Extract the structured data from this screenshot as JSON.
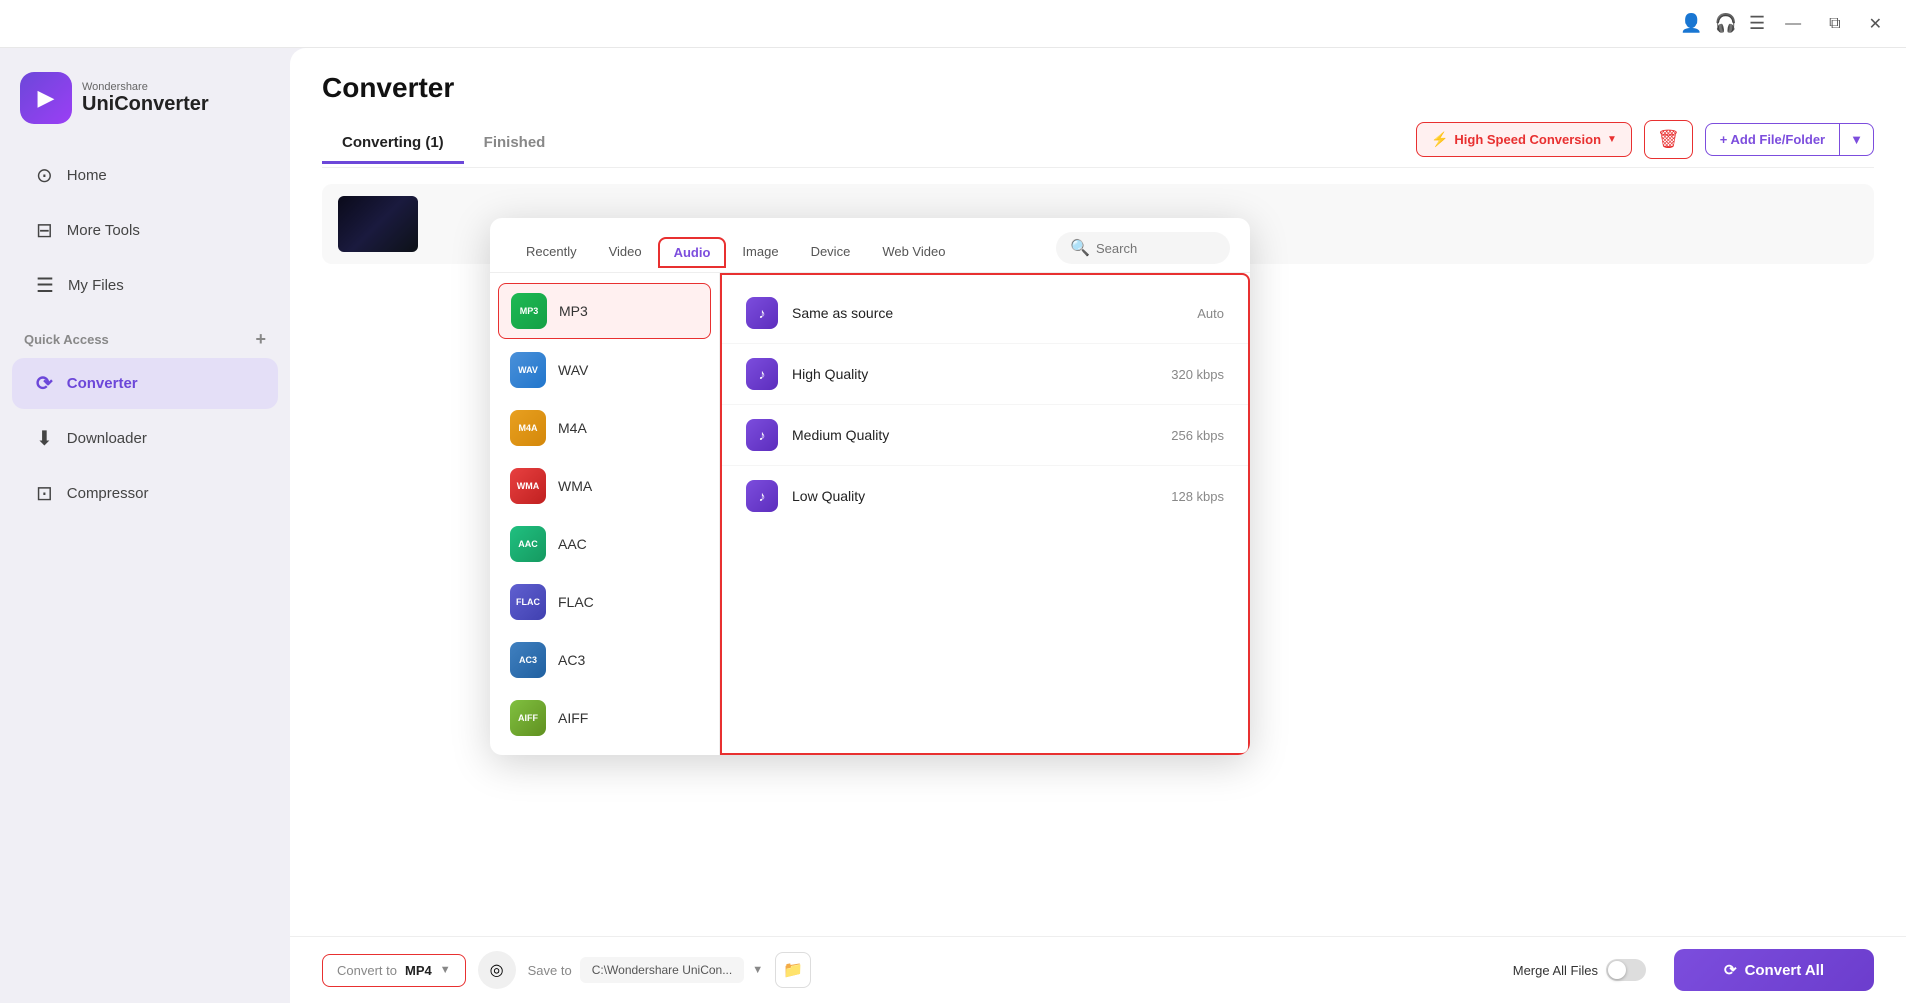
{
  "app": {
    "name": "Wondershare",
    "product": "UniConverter",
    "logo_emoji": "▶"
  },
  "titlebar": {
    "profile_icon": "👤",
    "headset_icon": "🎧",
    "menu_icon": "☰",
    "minimize_icon": "—",
    "maximize_icon": "⧉",
    "close_icon": "✕"
  },
  "sidebar": {
    "nav_items": [
      {
        "id": "home",
        "icon": "⊙",
        "label": "Home",
        "active": false
      },
      {
        "id": "more-tools",
        "icon": "⊟",
        "label": "More Tools",
        "active": false
      },
      {
        "id": "my-files",
        "icon": "☰",
        "label": "My Files",
        "active": false
      },
      {
        "id": "converter",
        "icon": "⟳",
        "label": "Converter",
        "active": true
      },
      {
        "id": "downloader",
        "icon": "⬇",
        "label": "Downloader",
        "active": false
      },
      {
        "id": "compressor",
        "icon": "⊡",
        "label": "Compressor",
        "active": false
      }
    ],
    "quick_access_label": "Quick Access",
    "quick_access_plus": "+"
  },
  "page": {
    "title": "Converter",
    "tabs": [
      {
        "id": "converting",
        "label": "Converting (1)",
        "active": true
      },
      {
        "id": "finished",
        "label": "Finished",
        "active": false
      }
    ]
  },
  "toolbar": {
    "high_speed_label": "High Speed Conversion",
    "high_speed_icon": "⚡",
    "delete_icon": "🗑",
    "add_file_label": "+ Add File/Folder",
    "add_file_arrow": "▼"
  },
  "format_dropdown": {
    "tabs": [
      {
        "id": "recently",
        "label": "Recently",
        "active": false
      },
      {
        "id": "video",
        "label": "Video",
        "active": false
      },
      {
        "id": "audio",
        "label": "Audio",
        "active": true
      },
      {
        "id": "image",
        "label": "Image",
        "active": false
      },
      {
        "id": "device",
        "label": "Device",
        "active": false
      },
      {
        "id": "web-video",
        "label": "Web Video",
        "active": false
      }
    ],
    "search_placeholder": "Search",
    "formats": [
      {
        "id": "mp3",
        "label": "MP3",
        "icon_class": "icon-mp3",
        "selected": true
      },
      {
        "id": "wav",
        "label": "WAV",
        "icon_class": "icon-wav",
        "selected": false
      },
      {
        "id": "m4a",
        "label": "M4A",
        "icon_class": "icon-m4a",
        "selected": false
      },
      {
        "id": "wma",
        "label": "WMA",
        "icon_class": "icon-wma",
        "selected": false
      },
      {
        "id": "aac",
        "label": "AAC",
        "icon_class": "icon-aac",
        "selected": false
      },
      {
        "id": "flac",
        "label": "FLAC",
        "icon_class": "icon-flac",
        "selected": false
      },
      {
        "id": "ac3",
        "label": "AC3",
        "icon_class": "icon-ac3",
        "selected": false
      },
      {
        "id": "aiff",
        "label": "AIFF",
        "icon_class": "icon-aiff",
        "selected": false
      }
    ],
    "qualities": [
      {
        "id": "same-as-source",
        "label": "Same as source",
        "value": "Auto"
      },
      {
        "id": "high-quality",
        "label": "High Quality",
        "value": "320 kbps"
      },
      {
        "id": "medium-quality",
        "label": "Medium Quality",
        "value": "256 kbps"
      },
      {
        "id": "low-quality",
        "label": "Low Quality",
        "value": "128 kbps"
      }
    ]
  },
  "bottom_bar": {
    "convert_to_label": "Convert to",
    "convert_to_value": "MP4",
    "target_icon": "◎",
    "save_to_label": "Save to",
    "save_to_path": "C:\\Wondershare UniCon...",
    "save_to_arrow": "▼",
    "folder_icon": "📁",
    "merge_files_label": "Merge All Files",
    "convert_all_label": "Convert All",
    "convert_all_icon": "⟳"
  }
}
